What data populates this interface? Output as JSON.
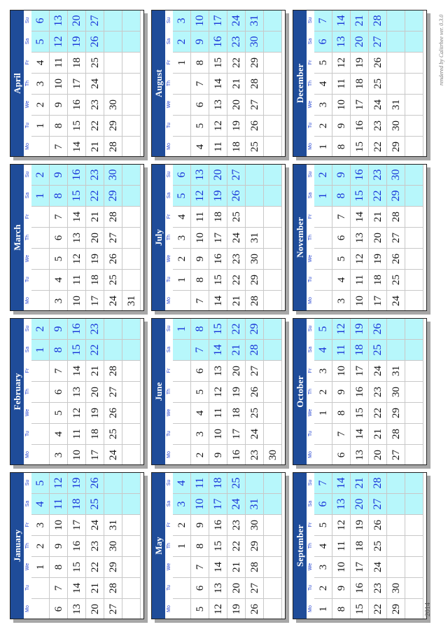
{
  "year": "2014",
  "credit": "rendered by Calitrhee ver. 0.3.0",
  "weekdays": [
    "Mo",
    "Tu",
    "We",
    "Th",
    "Fr",
    "Sa",
    "Su"
  ],
  "months": [
    {
      "name": "January",
      "start": 2,
      "days": 31
    },
    {
      "name": "February",
      "start": 5,
      "days": 28
    },
    {
      "name": "March",
      "start": 5,
      "days": 31
    },
    {
      "name": "April",
      "start": 1,
      "days": 30
    },
    {
      "name": "May",
      "start": 3,
      "days": 31
    },
    {
      "name": "June",
      "start": 6,
      "days": 30
    },
    {
      "name": "July",
      "start": 1,
      "days": 31
    },
    {
      "name": "August",
      "start": 4,
      "days": 31
    },
    {
      "name": "September",
      "start": 0,
      "days": 30
    },
    {
      "name": "October",
      "start": 2,
      "days": 31
    },
    {
      "name": "November",
      "start": 5,
      "days": 30
    },
    {
      "name": "December",
      "start": 0,
      "days": 31
    }
  ],
  "colors": {
    "header": "#1f4c99",
    "weekend": "#b7f7fb",
    "weekend_text": "#1632d8",
    "weekday_label": "#1f3fd0"
  }
}
